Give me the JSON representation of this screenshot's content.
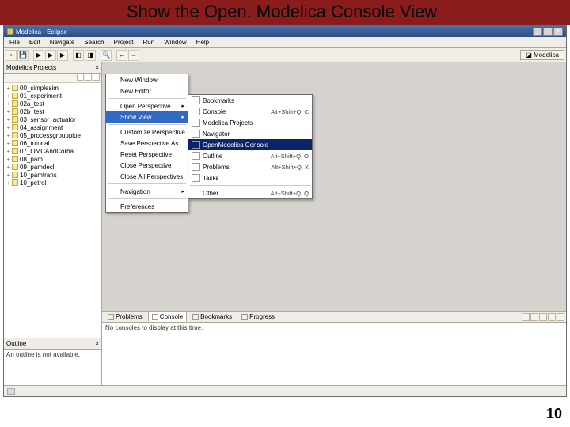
{
  "slide": {
    "title": "Show the Open. Modelica Console View",
    "page": "10"
  },
  "window": {
    "title": "Modelica - Eclipse"
  },
  "menubar": [
    "File",
    "Edit",
    "Navigate",
    "Search",
    "Project",
    "Run",
    "Window",
    "Help"
  ],
  "perspective": "Modelica",
  "projects_view": {
    "tab": "Modelica Projects",
    "items": [
      "00_simplesim",
      "01_experiment",
      "02a_test",
      "02b_test",
      "03_sensor_actuator",
      "04_assignment",
      "05_processgrouppipe",
      "06_tutorial",
      "07_OMCAndCorba",
      "08_pam",
      "09_pamdecl",
      "10_pamtrans",
      "10_petrol"
    ]
  },
  "outline": {
    "tab": "Outline",
    "message": "An outline is not available."
  },
  "bottom": {
    "tabs": [
      "Problems",
      "Console",
      "Bookmarks",
      "Progress"
    ],
    "active_index": 1,
    "message": "No consoles to display at this time."
  },
  "window_menu": {
    "items_top": [
      "New Window",
      "New Editor"
    ],
    "items_mid1": [
      "Open Perspective"
    ],
    "show_view": "Show View",
    "items_mid2": [
      "Customize Perspective...",
      "Save Perspective As...",
      "Reset Perspective",
      "Close Perspective",
      "Close All Perspectives"
    ],
    "items_mid3": [
      "Navigation"
    ],
    "items_bot": [
      "Preferences"
    ]
  },
  "show_view_submenu": [
    {
      "label": "Bookmarks",
      "shortcut": ""
    },
    {
      "label": "Console",
      "shortcut": "Alt+Shift+Q, C"
    },
    {
      "label": "Modelica Projects",
      "shortcut": ""
    },
    {
      "label": "Navigator",
      "shortcut": ""
    },
    {
      "label": "OpenModelica Console",
      "shortcut": "",
      "selected": true
    },
    {
      "label": "Outline",
      "shortcut": "Alt+Shift+Q, O"
    },
    {
      "label": "Problems",
      "shortcut": "Alt+Shift+Q, X"
    },
    {
      "label": "Tasks",
      "shortcut": ""
    }
  ],
  "show_view_other": {
    "label": "Other...",
    "shortcut": "Alt+Shift+Q, Q"
  }
}
